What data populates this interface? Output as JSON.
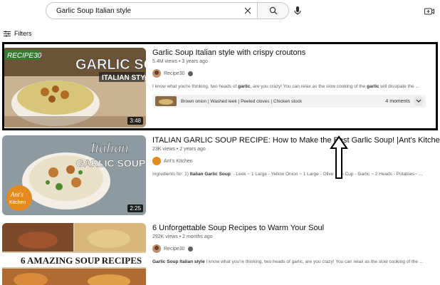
{
  "search": {
    "query": "Garlic Soup Italian style"
  },
  "filters": {
    "label": "Filters"
  },
  "results": [
    {
      "title": "Garlic Soup Italian style with crispy croutons",
      "views": "5.4M views",
      "age": "3 years ago",
      "channel": "Recipe30",
      "description_prefix": "I know what you're thinking, two heads of ",
      "description_bold1": "garlic",
      "description_mid": ", are you crazy! You can relax as the slow cooking of the ",
      "description_bold2": "garlic",
      "description_suffix": " will dissipate the ...",
      "thumb_text1": "GARLIC SOUP",
      "thumb_text2": "ITALIAN STYLE",
      "thumb_logo": "RECIPE30",
      "duration": "3:48",
      "chapters": "Brown onion | Washed leek | Peeled cloves | Chicken stock",
      "moments": "4 moments"
    },
    {
      "title": "ITALIAN GARLIC SOUP RECIPE: How to Make the Best Garlic Soup! |Ant's Kitchen",
      "views": "23K views",
      "age": "2 years ago",
      "channel": "Ant's Kitchen",
      "description_prefix": "Ingredients for: 1) ",
      "description_bold1": "Italian Garlic Soup",
      "description_suffix": ": - Leek ~ 1 Large - Yellow Onion ~ 1 Large - Olive ... ¾ Cup - Garlic ~ 2 Heads - Potatoes~ ...",
      "thumb_text1": "Italian",
      "thumb_text2": "GARLIC SOUP",
      "thumb_logo1": "Ant's",
      "thumb_logo2": "Kitchen",
      "duration": "2:25"
    },
    {
      "title": "6 Unforgettable Soup Recipes to Warm Your Soul",
      "views": "292K views",
      "age": "2 months ago",
      "channel": "Recipe30",
      "description_bold1": "Garlic Soup Italian style",
      "description_suffix": " I know what you're thinking, two heads of garlic, are you crazy! You can relax as the slow cooking of the ...",
      "thumb_text1": "6 AMAZING SOUP RECIPES"
    }
  ],
  "colors": {
    "highlight_border": "#000000",
    "thumb_overlay": "#c57a2d"
  },
  "icons": [
    "clear-icon",
    "search-icon",
    "mic-icon",
    "create-icon",
    "filters-icon",
    "verified-icon",
    "chevron-down-icon",
    "up-arrow-annotation"
  ]
}
